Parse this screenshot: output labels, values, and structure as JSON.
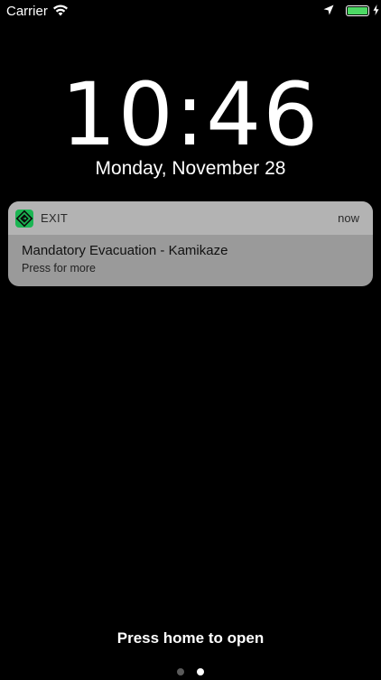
{
  "status_bar": {
    "carrier": "Carrier",
    "icons": [
      "wifi-icon",
      "location-arrow-icon",
      "battery-icon",
      "charging-bolt-icon"
    ],
    "battery_level": 1.0,
    "battery_color": "#4cd964"
  },
  "lock_screen": {
    "time": "10:46",
    "date": "Monday, November 28"
  },
  "notification": {
    "app_name": "EXIT",
    "app_icon": "exit-app-icon",
    "app_icon_color": "#1bb553",
    "time": "now",
    "title": "Mandatory Evacuation - Kamikaze",
    "body": "Press for more"
  },
  "footer": {
    "unlock_hint": "Press home to open",
    "page_count": 2,
    "active_page": 2
  }
}
